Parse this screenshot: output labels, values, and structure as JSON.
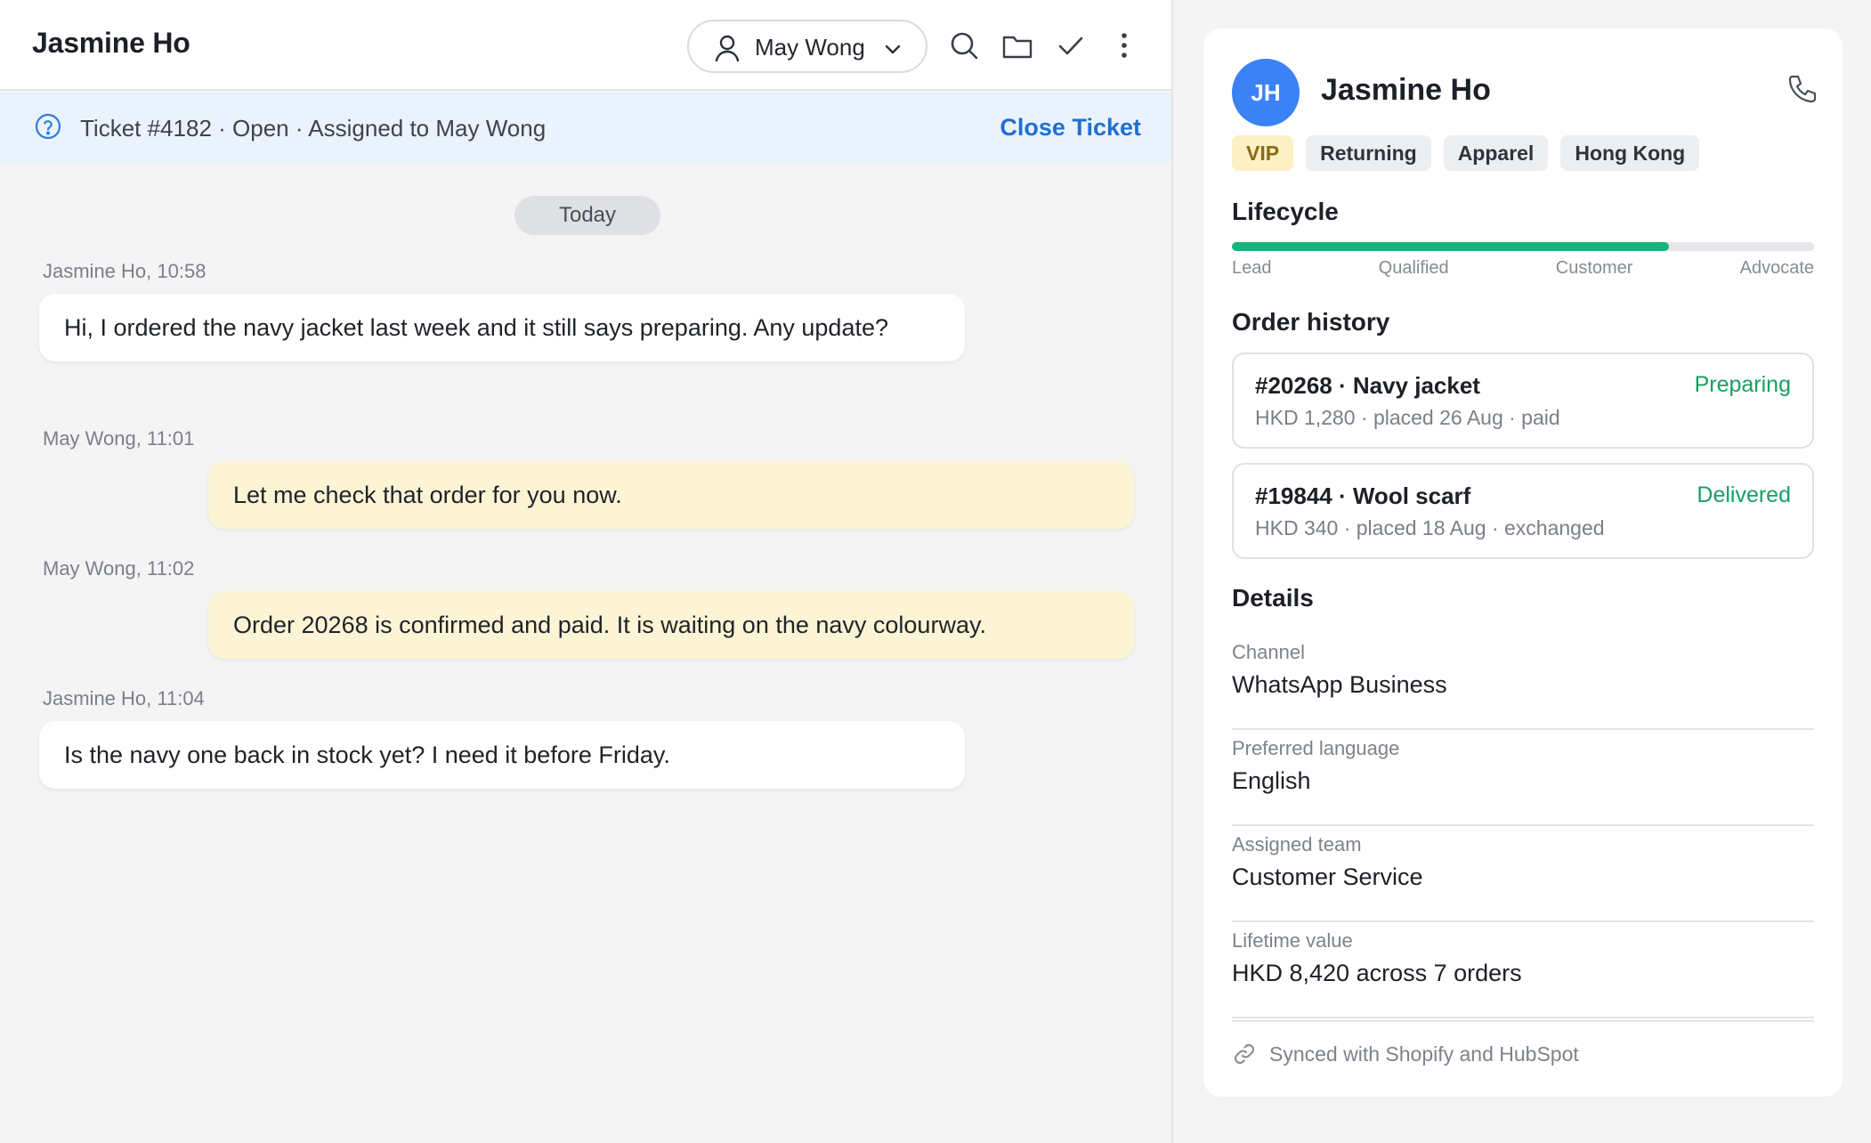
{
  "conversation": {
    "title": "Jasmine Ho",
    "assignee": "May Wong",
    "ticket": {
      "text": "Ticket #4182 · Open · Assigned to May Wong",
      "close_label": "Close Ticket"
    },
    "day_label": "Today",
    "messages": [
      {
        "meta": "Jasmine Ho, 10:58",
        "direction": "in",
        "text": "Hi, I ordered the navy jacket last week and it still says preparing. Any update?"
      },
      {
        "meta": "May Wong, 11:01",
        "direction": "out",
        "text": "Let me check that order for you now."
      },
      {
        "meta": "May Wong, 11:02",
        "direction": "out",
        "text": "Order 20268 is confirmed and paid. It is waiting on the navy colourway."
      },
      {
        "meta": "Jasmine Ho, 11:04",
        "direction": "in",
        "text": "Is the navy one back in stock yet? I need it before Friday."
      }
    ]
  },
  "customer": {
    "initials": "JH",
    "name": "Jasmine Ho",
    "tags": [
      "VIP",
      "Returning",
      "Apparel",
      "Hong Kong"
    ],
    "lifecycle": {
      "title": "Lifecycle",
      "stages": [
        "Lead",
        "Qualified",
        "Customer",
        "Advocate"
      ],
      "progress": 0.75
    },
    "order_history": {
      "title": "Order history",
      "orders": [
        {
          "title": "#20268 · Navy jacket",
          "sub": "HKD 1,280 · placed 26 Aug · paid",
          "status": "Preparing"
        },
        {
          "title": "#19844 · Wool scarf",
          "sub": "HKD 340 · placed 18 Aug · exchanged",
          "status": "Delivered"
        }
      ]
    },
    "details": {
      "title": "Details",
      "items": [
        {
          "label": "Channel",
          "value": "WhatsApp Business"
        },
        {
          "label": "Preferred language",
          "value": "English"
        },
        {
          "label": "Assigned team",
          "value": "Customer Service"
        },
        {
          "label": "Lifetime value",
          "value": "HKD 8,420 across 7 orders"
        }
      ]
    },
    "sync_text": "Synced with Shopify and HubSpot"
  },
  "colors": {
    "accent": "#1f6fd1",
    "avatar": "#3b82f6",
    "lifecycle_fill": "#16b57c",
    "status_ok": "#16a062",
    "outgoing_bubble": "#fdf4d6",
    "vip_tag": "#fdf0c4"
  },
  "icons": [
    "person-icon",
    "chevron-down-icon",
    "search-icon",
    "folder-icon",
    "check-icon",
    "more-vertical-icon",
    "help-circle-icon",
    "phone-icon",
    "link-icon"
  ]
}
